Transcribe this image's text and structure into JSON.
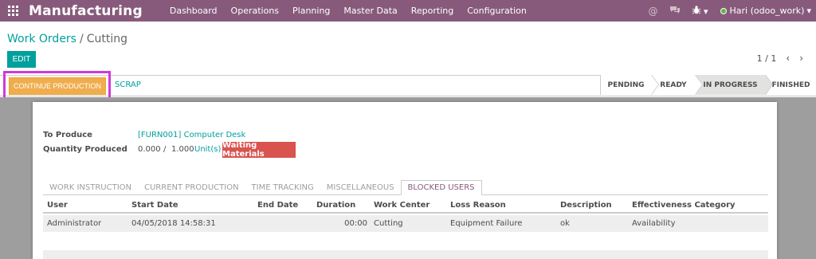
{
  "navbar": {
    "app_name": "Manufacturing",
    "menu": [
      "Dashboard",
      "Operations",
      "Planning",
      "Master Data",
      "Reporting",
      "Configuration"
    ],
    "icons": [
      "apps-grid-icon",
      "at-icon",
      "chat-icon",
      "bug-icon"
    ],
    "user": "Hari (odoo_work)",
    "user_caret": "▾",
    "bug_caret": "▾",
    "color": "#875a7b"
  },
  "breadcrumb": {
    "parent": "Work Orders",
    "separator": "/",
    "current": "Cutting"
  },
  "control": {
    "edit_label": "EDIT",
    "pager": "1 / 1",
    "prev": "‹",
    "next": "›"
  },
  "statusbar": {
    "continue_label": "CONTINUE PRODUCTION",
    "scrap_label": "SCRAP",
    "stages": [
      "PENDING",
      "READY",
      "IN PROGRESS",
      "FINISHED"
    ],
    "active_stage": "IN PROGRESS"
  },
  "form": {
    "to_produce_label": "To Produce",
    "to_produce_value": "[FURN001] Computer Desk",
    "qty_label": "Quantity Produced",
    "qty_done": "0.000",
    "qty_sep": "/",
    "qty_total": "1.000",
    "uom": "Unit(s)",
    "badge": "Waiting Materials"
  },
  "tabs": [
    "WORK INSTRUCTION",
    "CURRENT PRODUCTION",
    "TIME TRACKING",
    "MISCELLANEOUS",
    "BLOCKED USERS"
  ],
  "active_tab": "BLOCKED USERS",
  "table": {
    "columns": [
      "User",
      "Start Date",
      "End Date",
      "Duration",
      "Work Center",
      "Loss Reason",
      "Description",
      "Effectiveness Category"
    ],
    "rows": [
      [
        "Administrator",
        "04/05/2018 14:58:31",
        "",
        "00:00",
        "Cutting",
        "Equipment Failure",
        "ok",
        "Availability"
      ]
    ]
  }
}
